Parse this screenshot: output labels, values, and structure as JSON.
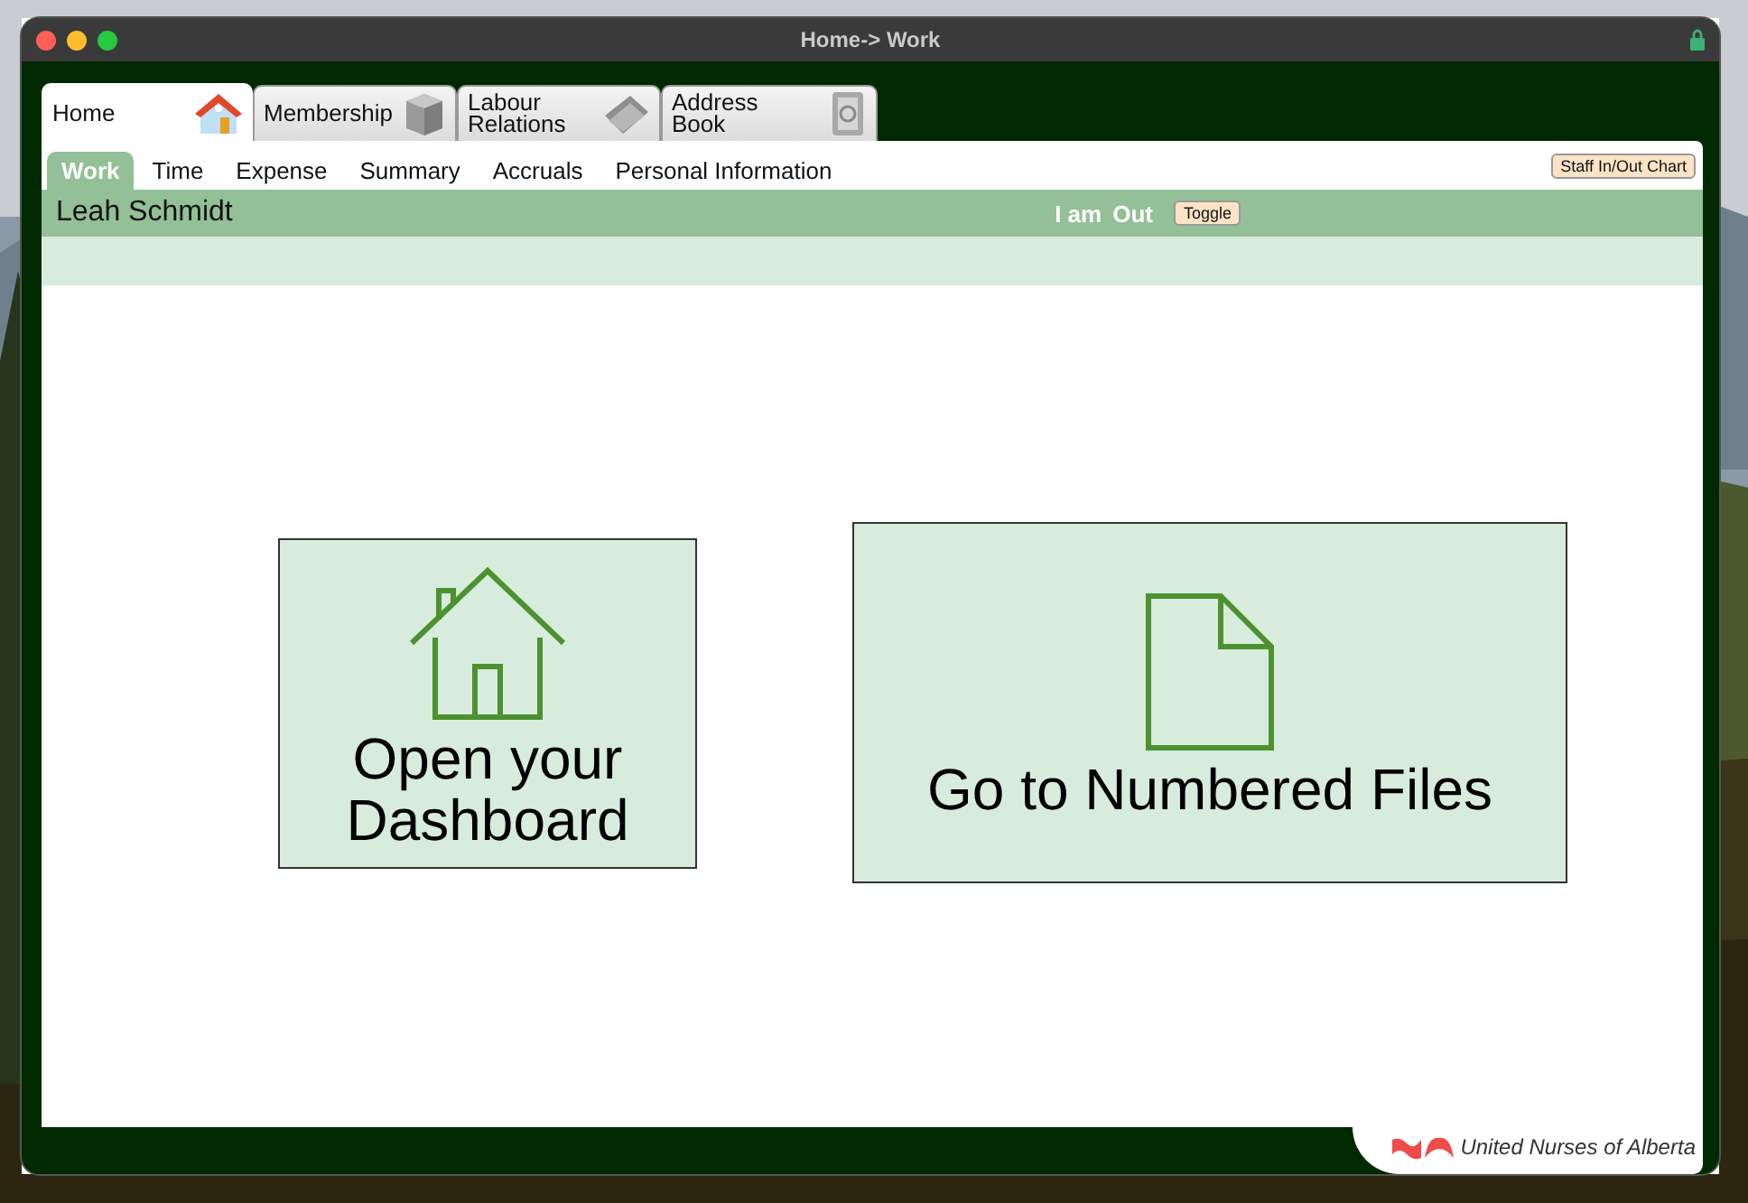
{
  "window": {
    "title": "Home-> Work"
  },
  "main_tabs": [
    {
      "label": "Home",
      "kind": "home",
      "selected": true
    },
    {
      "label": "Membership",
      "kind": "cube",
      "selected": false
    },
    {
      "label": "Labour Relations",
      "kind": "folder",
      "selected": false
    },
    {
      "label": "Address Book",
      "kind": "book",
      "selected": false
    }
  ],
  "sub_tabs": [
    {
      "label": "Work",
      "selected": true
    },
    {
      "label": "Time",
      "selected": false
    },
    {
      "label": "Expense",
      "selected": false
    },
    {
      "label": "Summary",
      "selected": false
    },
    {
      "label": "Accruals",
      "selected": false
    },
    {
      "label": "Personal Information",
      "selected": false
    }
  ],
  "staff_button": "Staff In/Out Chart",
  "user_bar": {
    "name": "Leah Schmidt",
    "status_label": "I am",
    "status": "Out",
    "toggle": "Toggle"
  },
  "cards": [
    {
      "label": "Open your Dashboard",
      "kind": "house"
    },
    {
      "label": "Go to Numbered Files",
      "kind": "file"
    }
  ],
  "footer": {
    "logo_text": "United Nurses of Alberta"
  }
}
